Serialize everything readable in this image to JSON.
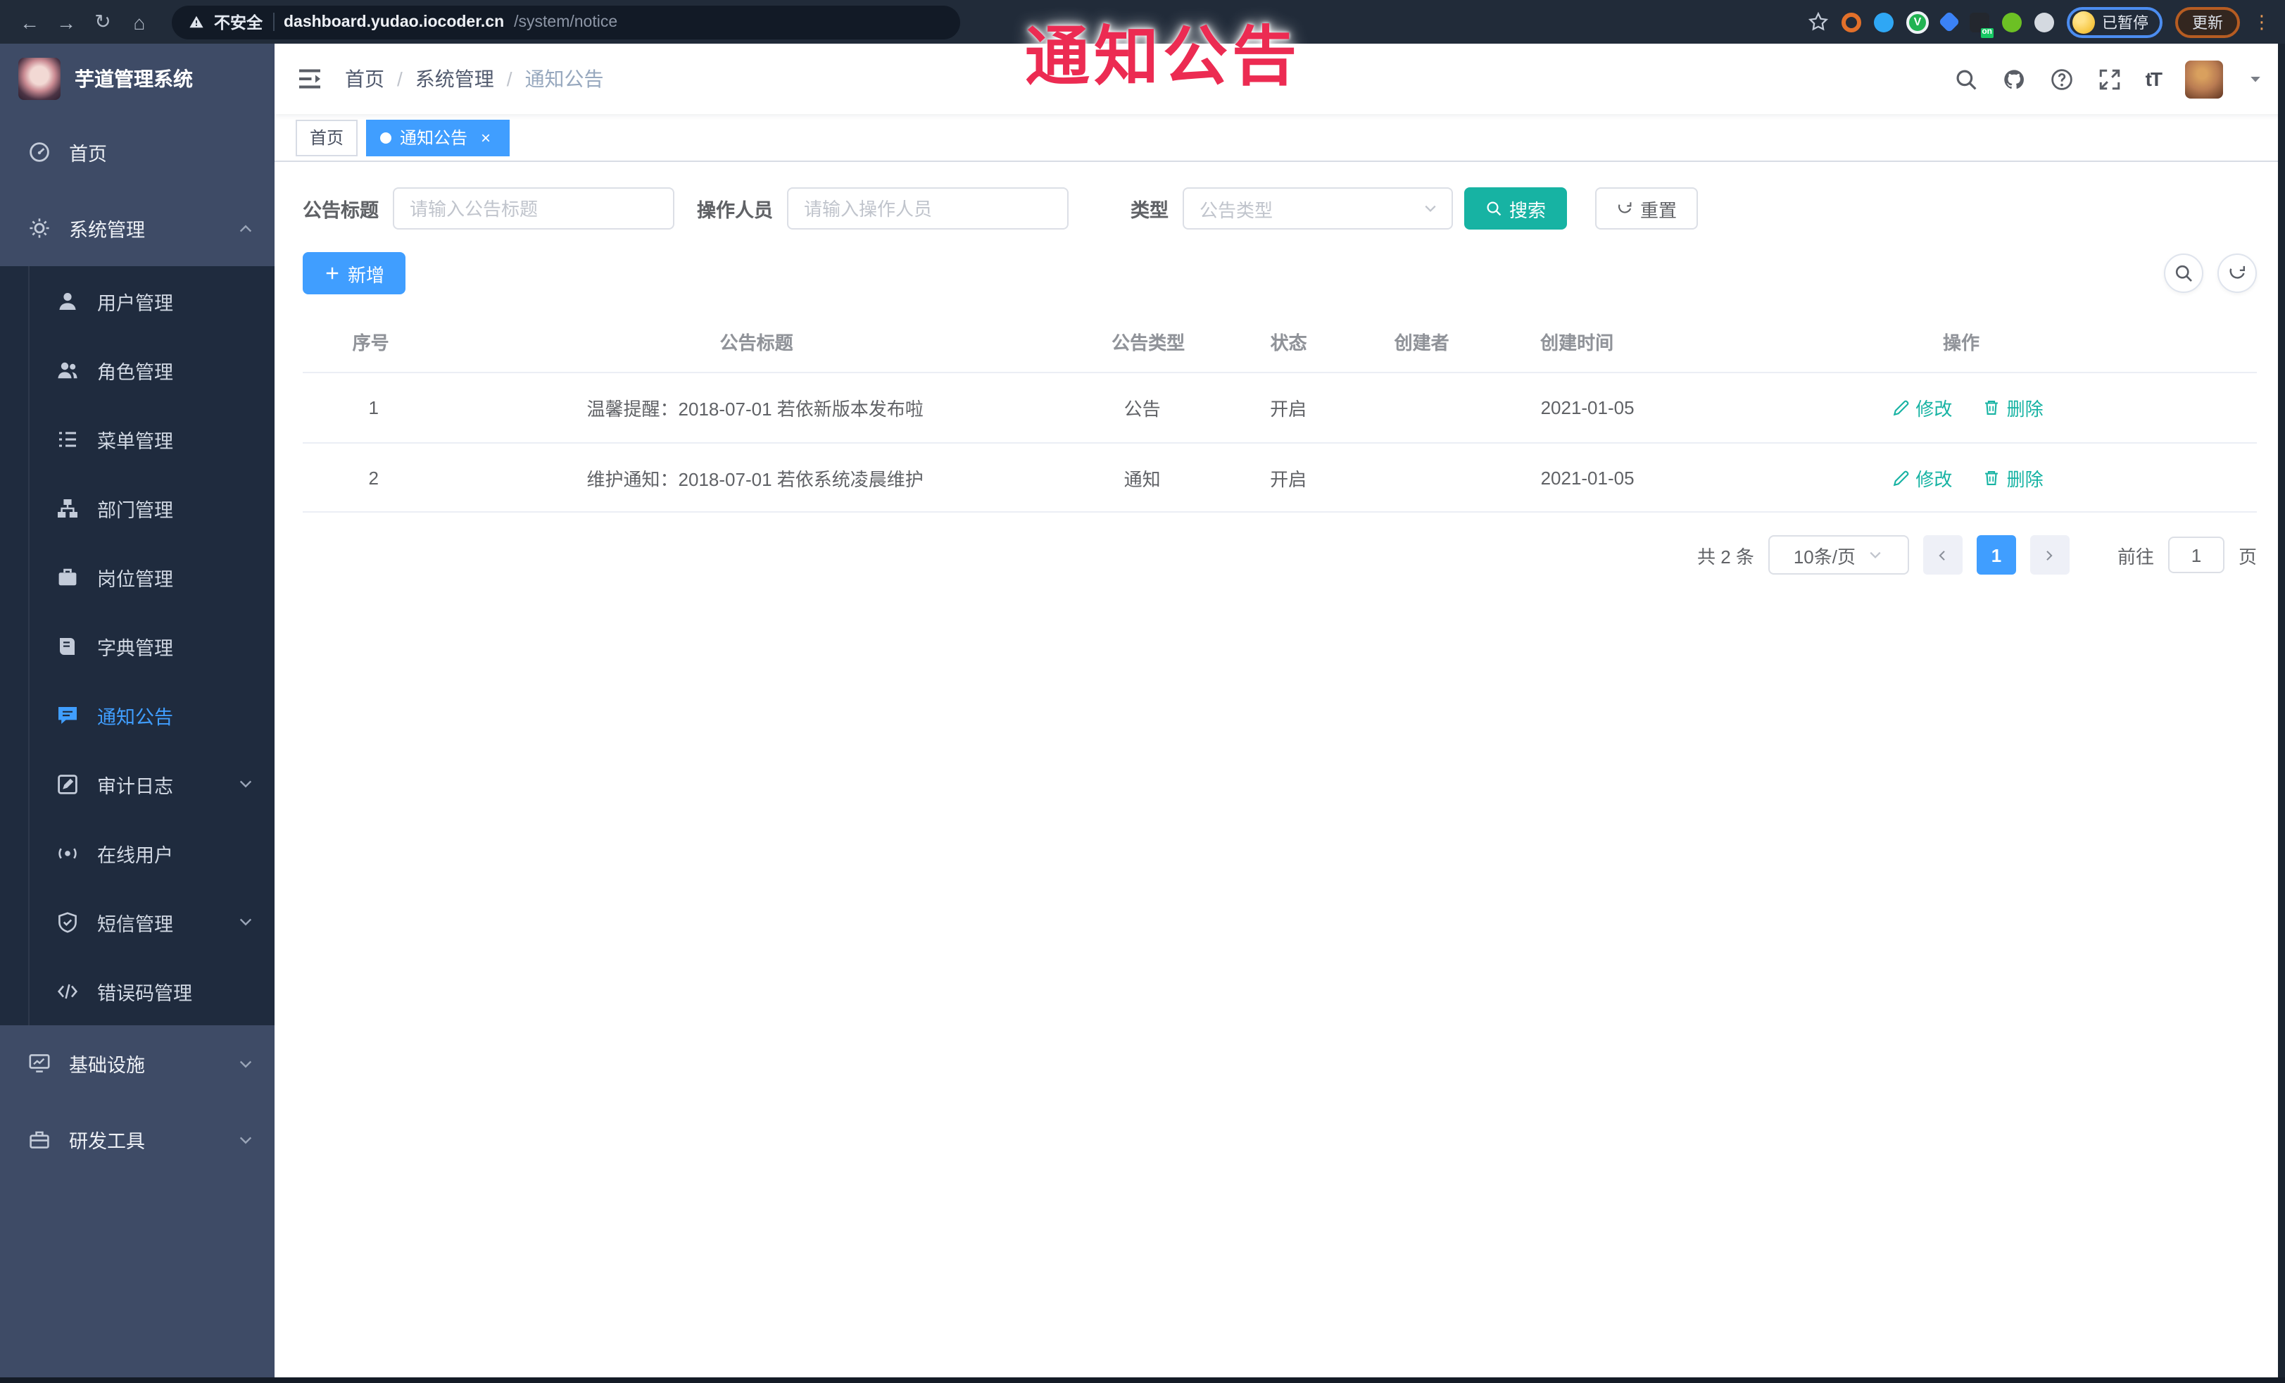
{
  "browser": {
    "security": "不安全",
    "host": "dashboard.yudao.iocoder.cn",
    "path": "/system/notice",
    "ext_badge": "on",
    "profile_status": "已暂停",
    "update": "更新"
  },
  "watermark": "通知公告",
  "sidebar": {
    "title": "芋道管理系统",
    "menu": [
      {
        "label": "首页",
        "icon": "gauge-icon"
      },
      {
        "label": "系统管理",
        "icon": "gear-icon",
        "expanded": true
      },
      {
        "label": "基础设施",
        "icon": "monitor-icon",
        "expanded": false
      },
      {
        "label": "研发工具",
        "icon": "toolbox-icon",
        "expanded": false
      }
    ],
    "submenu": [
      {
        "label": "用户管理",
        "icon": "user-icon"
      },
      {
        "label": "角色管理",
        "icon": "users-icon"
      },
      {
        "label": "菜单管理",
        "icon": "list-icon"
      },
      {
        "label": "部门管理",
        "icon": "tree-icon"
      },
      {
        "label": "岗位管理",
        "icon": "briefcase-icon"
      },
      {
        "label": "字典管理",
        "icon": "book-icon"
      },
      {
        "label": "通知公告",
        "icon": "message-icon",
        "active": true
      },
      {
        "label": "审计日志",
        "icon": "log-icon",
        "collapsible": true
      },
      {
        "label": "在线用户",
        "icon": "online-icon"
      },
      {
        "label": "短信管理",
        "icon": "shield-icon",
        "collapsible": true
      },
      {
        "label": "错误码管理",
        "icon": "code-icon"
      }
    ]
  },
  "navbar": {
    "breadcrumb": [
      "首页",
      "系统管理",
      "通知公告"
    ],
    "separator": "/",
    "font_size_label": "tT"
  },
  "tabs": [
    {
      "label": "首页",
      "active": false
    },
    {
      "label": "通知公告",
      "active": true,
      "closable": true
    }
  ],
  "filters": {
    "title_label": "公告标题",
    "title_placeholder": "请输入公告标题",
    "operator_label": "操作人员",
    "operator_placeholder": "请输入操作人员",
    "type_label": "类型",
    "type_placeholder": "公告类型",
    "search": "搜索",
    "reset": "重置"
  },
  "toolbar": {
    "add": "新增"
  },
  "table": {
    "headers": [
      "序号",
      "公告标题",
      "公告类型",
      "状态",
      "创建者",
      "创建时间",
      "操作"
    ],
    "rows": [
      {
        "no": "1",
        "title": "温馨提醒：2018-07-01 若依新版本发布啦",
        "type": "公告",
        "status": "开启",
        "creator": "",
        "time": "2021-01-05"
      },
      {
        "no": "2",
        "title": "维护通知：2018-07-01 若依系统凌晨维护",
        "type": "通知",
        "status": "开启",
        "creator": "",
        "time": "2021-01-05"
      }
    ],
    "actions": {
      "modify": "修改",
      "delete": "删除"
    }
  },
  "pagination": {
    "total": "共 2 条",
    "page_size": "10条/页",
    "page": "1",
    "goto": "前往",
    "goto_value": "1",
    "unit": "页"
  },
  "colors": {
    "primary": "#409eff",
    "teal": "#17b3a3",
    "watermark": "#ec2b52"
  }
}
